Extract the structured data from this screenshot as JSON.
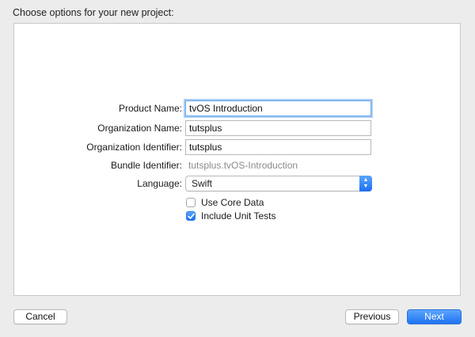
{
  "header": {
    "title": "Choose options for your new project:"
  },
  "form": {
    "product_name": {
      "label": "Product Name:",
      "value": "tvOS Introduction"
    },
    "organization_name": {
      "label": "Organization Name:",
      "value": "tutsplus"
    },
    "organization_identifier": {
      "label": "Organization Identifier:",
      "value": "tutsplus"
    },
    "bundle_identifier": {
      "label": "Bundle Identifier:",
      "value": "tutsplus.tvOS-Introduction"
    },
    "language": {
      "label": "Language:",
      "value": "Swift"
    },
    "use_core_data": {
      "label": "Use Core Data",
      "checked": false
    },
    "include_unit_tests": {
      "label": "Include Unit Tests",
      "checked": true
    }
  },
  "buttons": {
    "cancel": "Cancel",
    "previous": "Previous",
    "next": "Next"
  },
  "colors": {
    "accent": "#1f72f3",
    "focus_ring": "#a8cdf6",
    "background": "#ececec"
  }
}
